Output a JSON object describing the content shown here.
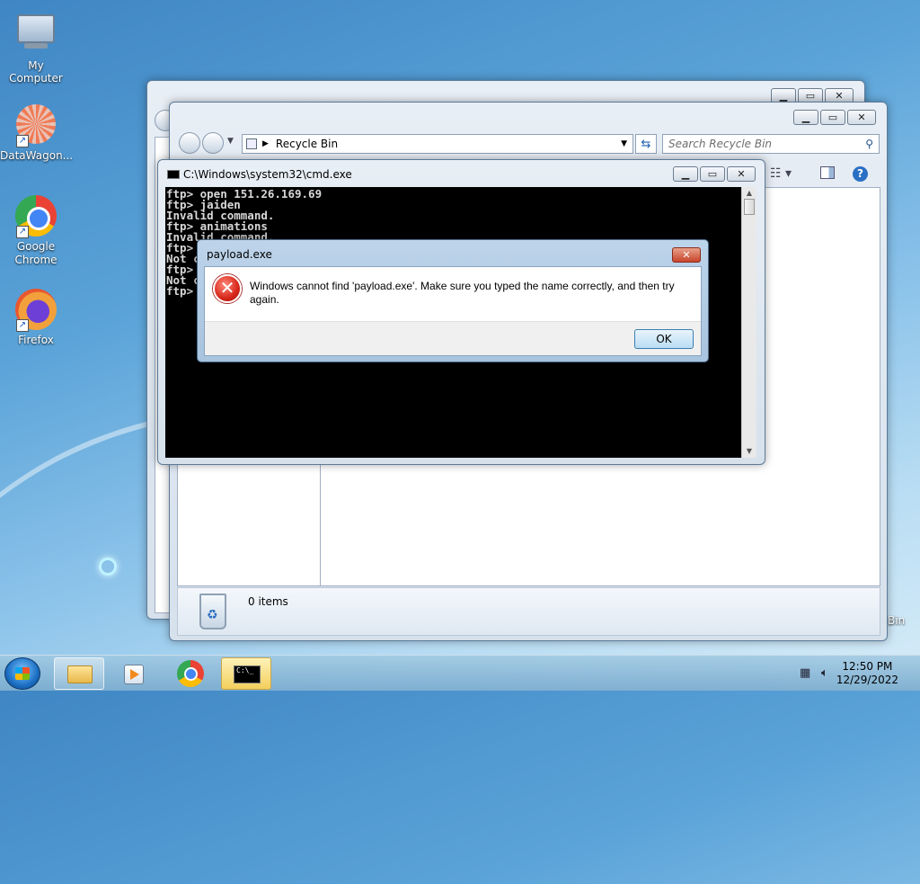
{
  "desktop": {
    "icons": [
      {
        "label": "My Computer",
        "icon": "computer-icon"
      },
      {
        "label": "DataWagon...",
        "icon": "datawagon-icon"
      },
      {
        "label": "Google\nChrome",
        "icon": "chrome-icon"
      },
      {
        "label": "Firefox",
        "icon": "firefox-icon"
      }
    ],
    "partial_label": "Bin"
  },
  "explorer": {
    "address": "Recycle Bin",
    "search_placeholder": "Search Recycle Bin",
    "status_count": "0 items"
  },
  "cmd": {
    "title": "C:\\Windows\\system32\\cmd.exe",
    "lines": [
      "ftp> open 151.26.169.69",
      "ftp> jaiden",
      "Invalid command.",
      "ftp> animations",
      "Invalid command.",
      "ftp> ",
      "Not c",
      "ftp> ",
      "Not c",
      "ftp> "
    ]
  },
  "dialog": {
    "title": "payload.exe",
    "message": "Windows cannot find 'payload.exe'. Make sure you typed the name correctly, and then try again.",
    "ok_label": "OK"
  },
  "taskbar": {
    "time": "12:50 PM",
    "date": "12/29/2022"
  },
  "colors": {
    "error_red": "#d7271a",
    "ok_button_border": "#3c7fb1"
  }
}
